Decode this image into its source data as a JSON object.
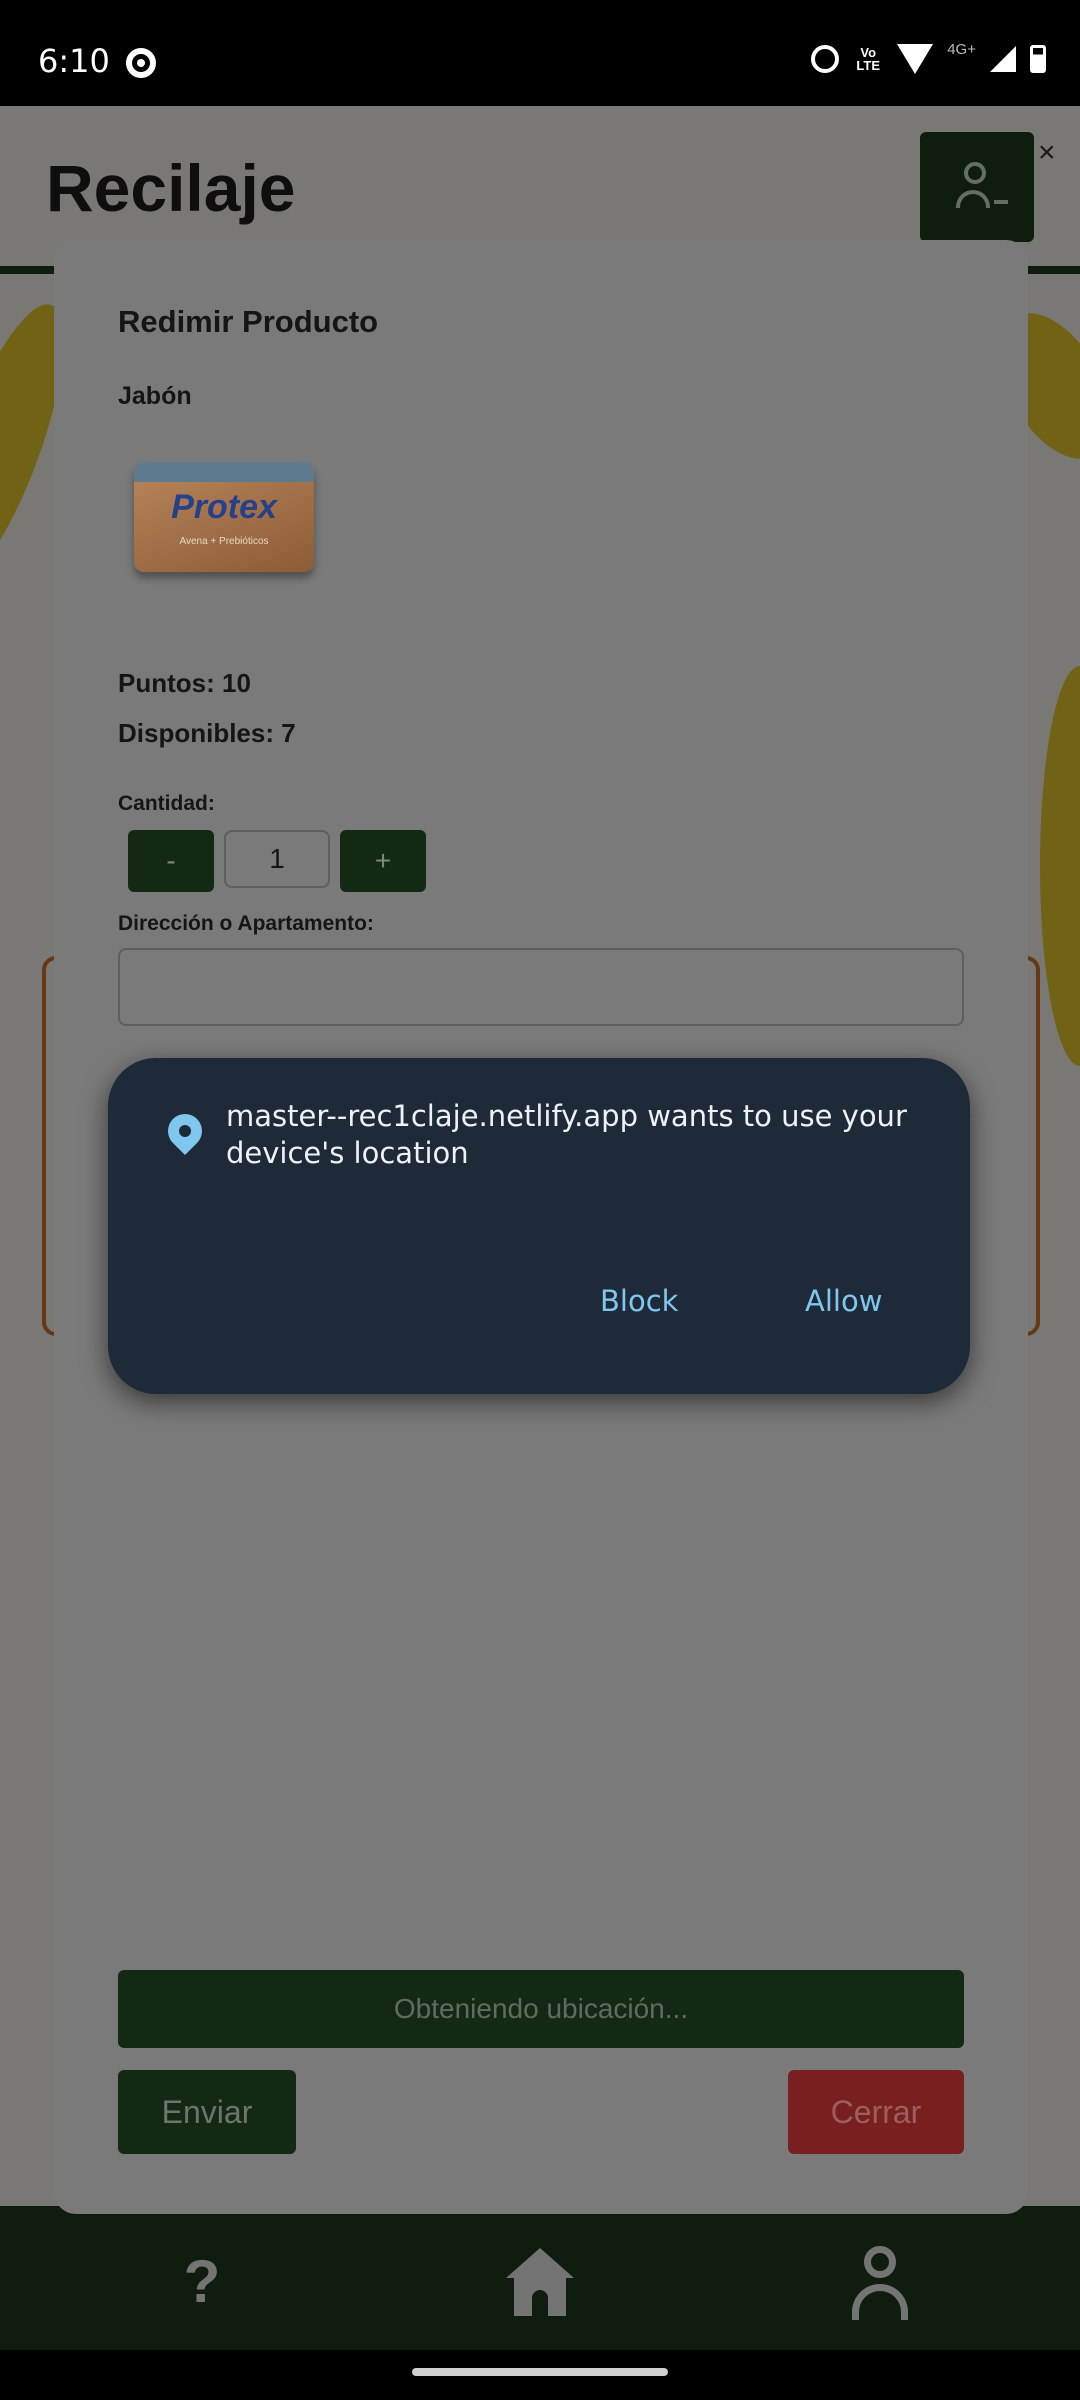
{
  "status_bar": {
    "time": "6:10",
    "volte": "Vo LTE",
    "network": "4G+"
  },
  "app": {
    "title": "Recilaje",
    "close_symbol": "×",
    "nav": {
      "help_icon": "?",
      "home_icon": "home-icon",
      "profile_icon": "person-icon"
    }
  },
  "modal": {
    "title": "Redimir Producto",
    "product_name": "Jabón",
    "product_image": {
      "brand": "Protex",
      "tagline": "Avena + Prebióticos"
    },
    "points_label": "Puntos: 10",
    "available_label": "Disponibles: 7",
    "quantity_label": "Cantidad:",
    "quantity_minus": "-",
    "quantity_value": "1",
    "quantity_plus": "+",
    "address_label": "Dirección o Apartamento:",
    "address_value": "",
    "location_button": "Obteniendo ubicación...",
    "send_button": "Enviar",
    "close_button": "Cerrar"
  },
  "permission_dialog": {
    "message": "master--rec1claje.netlify.app wants to use your device's location",
    "block": "Block",
    "allow": "Allow"
  },
  "colors": {
    "app_green": "#1e3a1c",
    "dialog_bg": "#1e2a38",
    "dialog_accent": "#7fc7ef",
    "close_red": "#7a1f1f"
  }
}
